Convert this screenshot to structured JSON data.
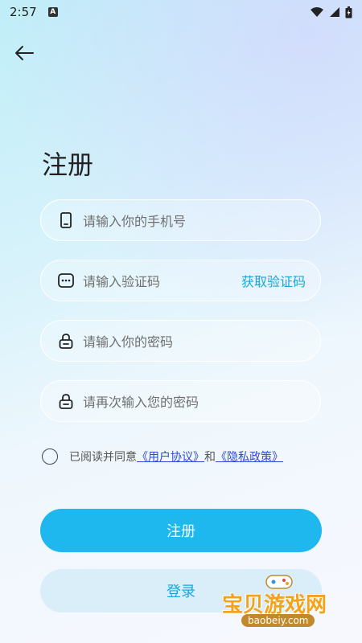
{
  "status_bar": {
    "time": "2:57",
    "sim_label": "A"
  },
  "page": {
    "title": "注册"
  },
  "form": {
    "phone_placeholder": "请输入你的手机号",
    "code_placeholder": "请输入验证码",
    "get_code_label": "获取验证码",
    "password_placeholder": "请输入你的密码",
    "confirm_placeholder": "请再次输入您的密码"
  },
  "agreement": {
    "prefix": "已阅读并同意",
    "user_agreement": "《用户协议》",
    "conjunction": "和",
    "privacy_policy": "《隐私政策》",
    "checked": false
  },
  "buttons": {
    "register_label": "注册",
    "login_label": "登录"
  },
  "watermark": {
    "title": "宝贝游戏网",
    "domain": "baobeiy.com"
  },
  "colors": {
    "accent": "#1eb8ee",
    "link": "#2f49d8",
    "secondary_bg": "#d9eef8"
  }
}
